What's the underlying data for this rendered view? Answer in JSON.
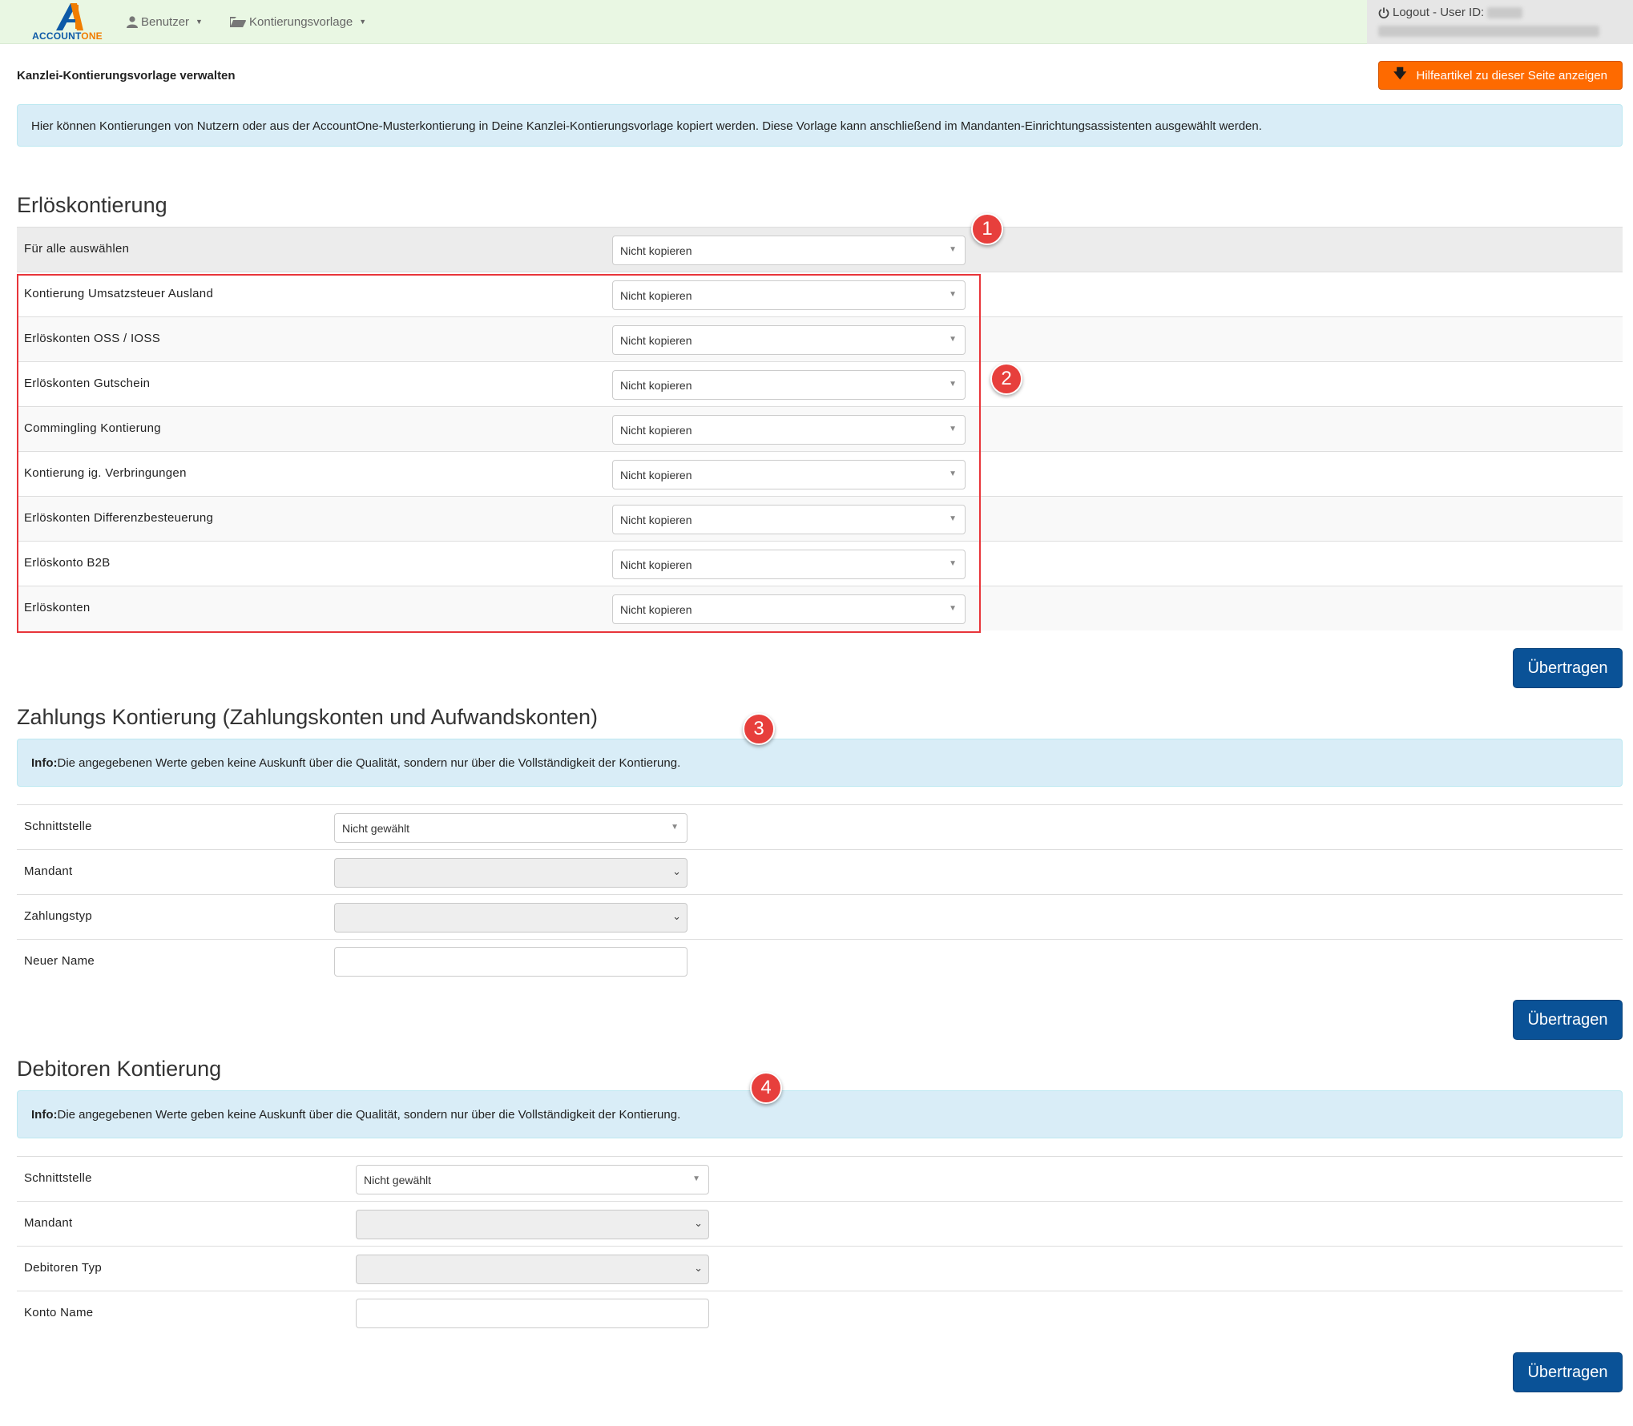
{
  "navbar": {
    "logo_text_1": "ACCOUNT",
    "logo_text_2": "ONE",
    "menu": [
      {
        "label": "Benutzer",
        "icon": "user-icon"
      },
      {
        "label": "Kontierungsvorlage",
        "icon": "folder-open-icon"
      }
    ],
    "logout_label": "Logout - User ID:"
  },
  "header": {
    "title": "Kanzlei-Kontierungsvorlage verwalten",
    "help_button": "Hilfeartikel zu dieser Seite anzeigen",
    "info": "Hier können Kontierungen von Nutzern oder aus der AccountOne-Musterkontierung in Deine Kanzlei-Kontierungsvorlage kopiert werden. Diese Vorlage kann anschließend im Mandanten-Einrichtungsassistenten ausgewählt werden."
  },
  "erloes": {
    "title": "Erlöskontierung",
    "select_all_label": "Für alle auswählen",
    "select_all_value": "Nicht kopieren",
    "rows": [
      {
        "label": "Kontierung Umsatzsteuer Ausland",
        "value": "Nicht kopieren"
      },
      {
        "label": "Erlöskonten OSS / IOSS",
        "value": "Nicht kopieren"
      },
      {
        "label": "Erlöskonten Gutschein",
        "value": "Nicht kopieren"
      },
      {
        "label": "Commingling Kontierung",
        "value": "Nicht kopieren"
      },
      {
        "label": "Kontierung ig. Verbringungen",
        "value": "Nicht kopieren"
      },
      {
        "label": "Erlöskonten Differenzbesteuerung",
        "value": "Nicht kopieren"
      },
      {
        "label": "Erlöskonto B2B",
        "value": "Nicht kopieren"
      },
      {
        "label": "Erlöskonten",
        "value": "Nicht kopieren"
      }
    ],
    "submit": "Übertragen"
  },
  "zahlung": {
    "title": "Zahlungs Kontierung (Zahlungskonten und Aufwandskonten)",
    "info_bold": "Info:",
    "info_text": "Die angegebenen Werte geben keine Auskunft über die Qualität, sondern nur über die Vollständigkeit der Kontierung.",
    "rows": [
      {
        "label": "Schnittstelle",
        "value": "Nicht gewählt"
      },
      {
        "label": "Mandant",
        "value": ""
      },
      {
        "label": "Zahlungstyp",
        "value": ""
      },
      {
        "label": "Neuer Name",
        "value": ""
      }
    ],
    "submit": "Übertragen"
  },
  "debitoren": {
    "title": "Debitoren Kontierung",
    "info_bold": "Info:",
    "info_text": "Die angegebenen Werte geben keine Auskunft über die Qualität, sondern nur über die Vollständigkeit der Kontierung.",
    "rows": [
      {
        "label": "Schnittstelle",
        "value": "Nicht gewählt"
      },
      {
        "label": "Mandant",
        "value": ""
      },
      {
        "label": "Debitoren Typ",
        "value": ""
      },
      {
        "label": "Konto Name",
        "value": ""
      }
    ],
    "submit": "Übertragen"
  },
  "annotations": [
    "1",
    "2",
    "3",
    "4"
  ],
  "colors": {
    "navbar_bg": "#e9f7e3",
    "help_button": "#fe6a00",
    "primary_button": "#0a5297",
    "info_bg": "#d9edf7",
    "annotation_red": "#e73f3c"
  }
}
